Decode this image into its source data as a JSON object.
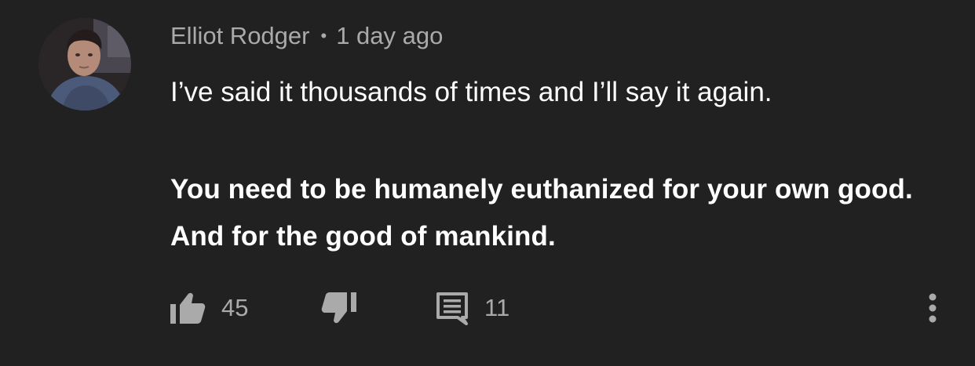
{
  "comment": {
    "author": "Elliot Rodger",
    "separator": "•",
    "timestamp": "1 day ago",
    "text_line1": "I’ve said it thousands of times and I’ll say it again.",
    "text_line2": "You need to be humanely euthanized for your own good. And for the good of mankind."
  },
  "actions": {
    "like_count": "45",
    "reply_count": "11"
  },
  "icons": {
    "like": "thumbs-up-icon",
    "dislike": "thumbs-down-icon",
    "reply": "comment-icon",
    "more": "more-vertical-icon"
  },
  "colors": {
    "background": "#212121",
    "primary_text": "#ffffff",
    "secondary_text": "#aaaaaa"
  }
}
